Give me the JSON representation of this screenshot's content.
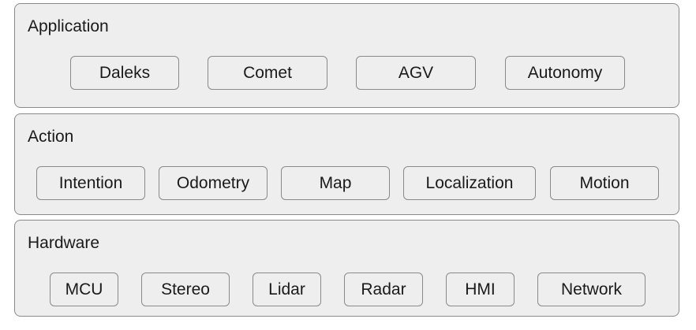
{
  "layers": [
    {
      "title": "Application",
      "items": [
        "Daleks",
        "Comet",
        "AGV",
        "Autonomy"
      ]
    },
    {
      "title": "Action",
      "items": [
        "Intention",
        "Odometry",
        "Map",
        "Localization",
        "Motion"
      ]
    },
    {
      "title": "Hardware",
      "items": [
        "MCU",
        "Stereo",
        "Lidar",
        "Radar",
        "HMI",
        "Network"
      ]
    }
  ]
}
